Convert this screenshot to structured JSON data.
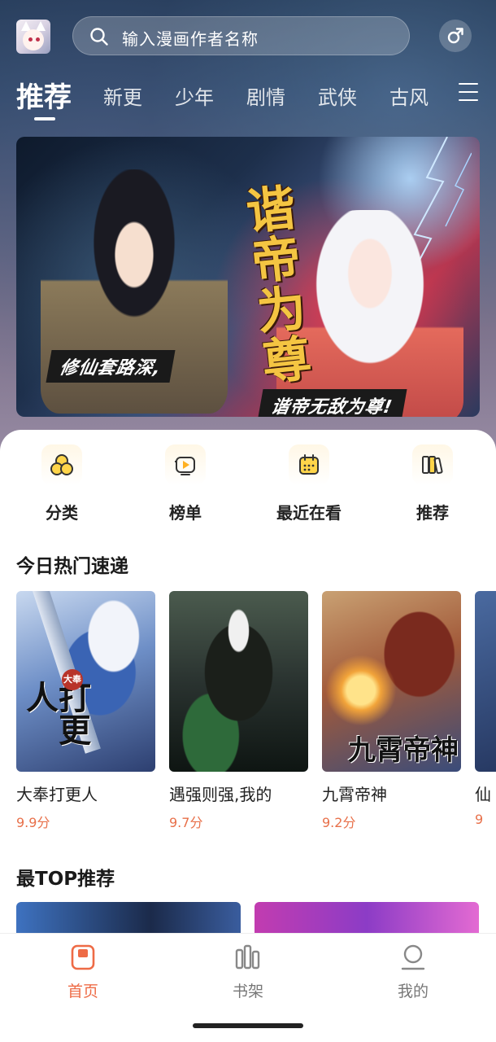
{
  "header": {
    "search_placeholder": "输入漫画作者名称"
  },
  "tabs": [
    {
      "label": "推荐",
      "active": true
    },
    {
      "label": "新更",
      "active": false
    },
    {
      "label": "少年",
      "active": false
    },
    {
      "label": "剧情",
      "active": false
    },
    {
      "label": "武侠",
      "active": false
    },
    {
      "label": "古风",
      "active": false
    }
  ],
  "banner": {
    "title_art": "谐帝为尊",
    "tagline_left": "修仙套路深,",
    "tagline_right": "谐帝无敌为尊!"
  },
  "quick_links": [
    {
      "label": "分类",
      "icon": "category-icon"
    },
    {
      "label": "榜单",
      "icon": "ranking-icon"
    },
    {
      "label": "最近在看",
      "icon": "calendar-icon"
    },
    {
      "label": "推荐",
      "icon": "bookshelf-icon"
    }
  ],
  "sections": {
    "hot_title": "今日热门速递",
    "top_title": "最TOP推荐"
  },
  "hot_comics": [
    {
      "title": "大奉打更人",
      "score": "9.9分",
      "cover_text": "打更人",
      "cover_badge": "大奉"
    },
    {
      "title": "遇强则强,我的",
      "score": "9.7分"
    },
    {
      "title": "九霄帝神",
      "score": "9.2分",
      "cover_text": "九霄帝神"
    },
    {
      "title": "仙",
      "score": "9"
    }
  ],
  "bottom_nav": [
    {
      "label": "首页",
      "active": true
    },
    {
      "label": "书架",
      "active": false
    },
    {
      "label": "我的",
      "active": false
    }
  ],
  "colors": {
    "accent": "#ee6b46",
    "score": "#e8704a"
  }
}
